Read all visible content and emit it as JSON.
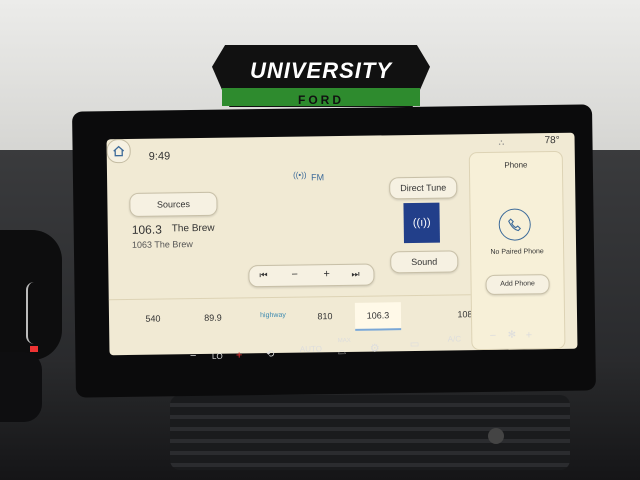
{
  "logo": {
    "brand": "UNIVERSITY",
    "sub": "FORD"
  },
  "status": {
    "time": "9:49",
    "temperature": "78°"
  },
  "source_indicator": "FM",
  "buttons": {
    "sources": "Sources",
    "direct_tune": "Direct Tune",
    "sound": "Sound"
  },
  "now_playing": {
    "frequency": "106.3",
    "station": "The Brew",
    "subtitle": "1063 The Brew"
  },
  "controls": {
    "prev": "⏮",
    "minus": "−",
    "plus": "+",
    "next": "⏭"
  },
  "presets": [
    {
      "label": "540"
    },
    {
      "label": "89.9"
    },
    {
      "label": "highway"
    },
    {
      "label": "810"
    },
    {
      "label": "106.3",
      "selected": true
    },
    {
      "label": ""
    },
    {
      "label": "108"
    }
  ],
  "phone": {
    "title": "Phone",
    "status": "No Paired Phone",
    "add_label": "Add Phone"
  },
  "climate": {
    "minus_left": "−",
    "lo": "LO",
    "plus_left": "+",
    "auto": "AUTO",
    "max": "MAX",
    "ac": "A/C",
    "minus_right": "−",
    "plus_right": "+"
  },
  "colors": {
    "screen_bg": "#f1ead4",
    "accent_blue": "#223f8a",
    "indicator_red": "#e33333",
    "logo_green": "#2e8b2e"
  }
}
